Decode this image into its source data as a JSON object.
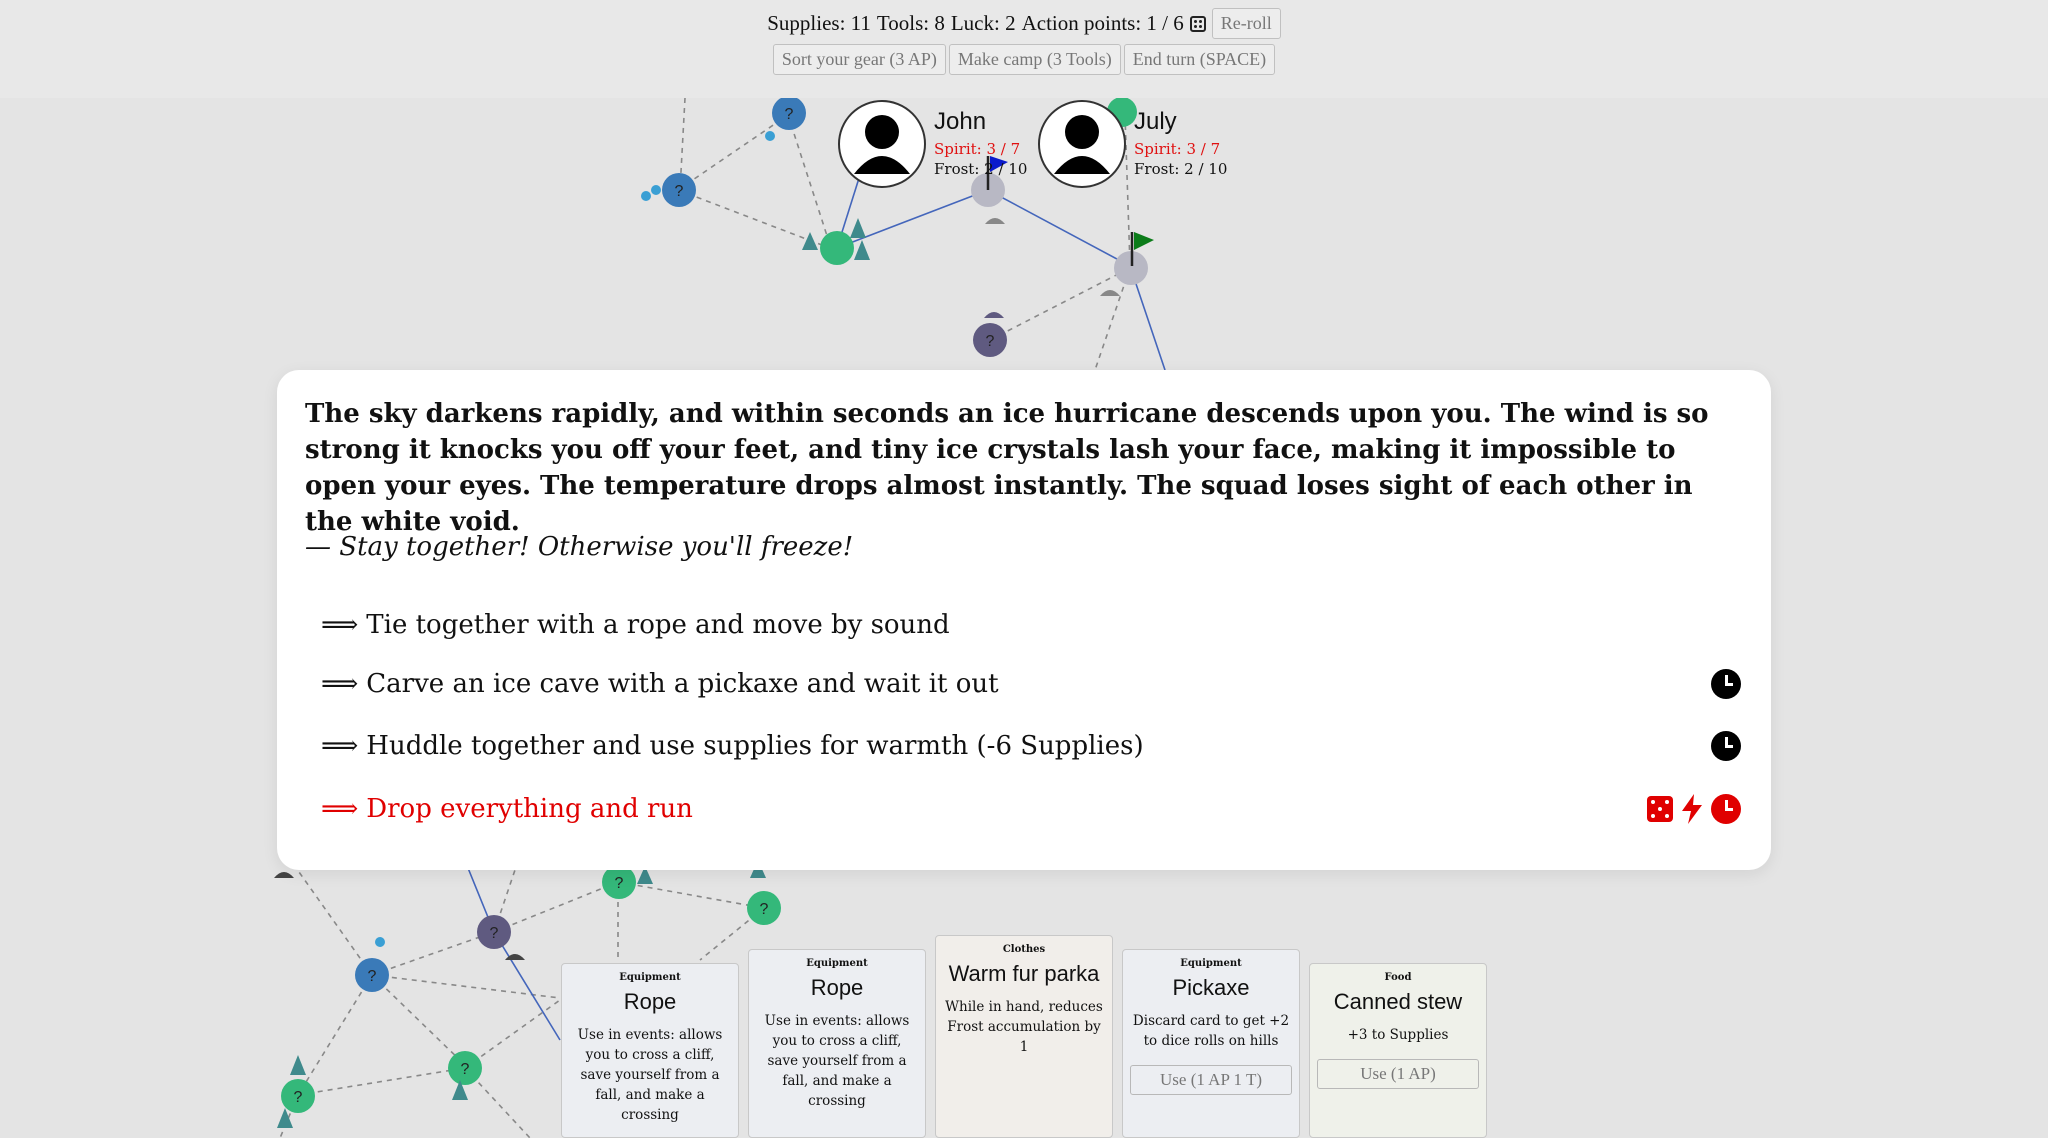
{
  "topbar": {
    "supplies": "Supplies: 11",
    "tools": "Tools: 8",
    "luck": "Luck: 2",
    "action_points": "Action points: 1 / 6",
    "reroll_label": "Re-roll",
    "buttons": [
      "Sort your gear (3 AP)",
      "Make camp (3 Tools)",
      "End turn (SPACE)"
    ]
  },
  "characters": [
    {
      "name": "John",
      "spirit": "Spirit: 3 / 7",
      "frost": "Frost: 2 / 10"
    },
    {
      "name": "July",
      "spirit": "Spirit: 3 / 7",
      "frost": "Frost: 2 / 10"
    }
  ],
  "map_nodes": {
    "unknown_label": "?"
  },
  "event": {
    "text": "The sky darkens rapidly, and within seconds an ice hurricane descends upon you. The wind is so strong it knocks you off your feet, and tiny ice crystals lash your face, making it impossible to open your eyes. The temperature drops almost instantly. The squad loses sight of each other in the white void.",
    "quote": "— Stay together! Otherwise you'll freeze!",
    "arrow": "⟹",
    "options": [
      {
        "label": "Tie together with a rope and move by sound"
      },
      {
        "label": "Carve an ice cave with a pickaxe and wait it out"
      },
      {
        "label": "Huddle together and use supplies for warmth (-6 Supplies)"
      },
      {
        "label": "Drop everything and run"
      }
    ]
  },
  "cards": [
    {
      "type": "Equipment",
      "title": "Rope",
      "desc": "Use in events: allows you to cross a cliff, save yourself from a fall, and make a crossing"
    },
    {
      "type": "Equipment",
      "title": "Rope",
      "desc": "Use in events: allows you to cross a cliff, save yourself from a fall, and make a crossing"
    },
    {
      "type": "Clothes",
      "title": "Warm fur parka",
      "desc": "While in hand, reduces Frost accumulation by 1"
    },
    {
      "type": "Equipment",
      "title": "Pickaxe",
      "desc": "Discard card to get +2 to dice rolls on hills",
      "use": "Use (1 AP 1 T)"
    },
    {
      "type": "Food",
      "title": "Canned stew",
      "desc": "+3 to Supplies",
      "use": "Use (1 AP)"
    }
  ],
  "colors": {
    "red": "#e00000",
    "blue_node": "#3a7ab8",
    "green_node": "#34b87a",
    "purple_node": "#5f5a80",
    "grey_node": "#b8b8c4"
  }
}
